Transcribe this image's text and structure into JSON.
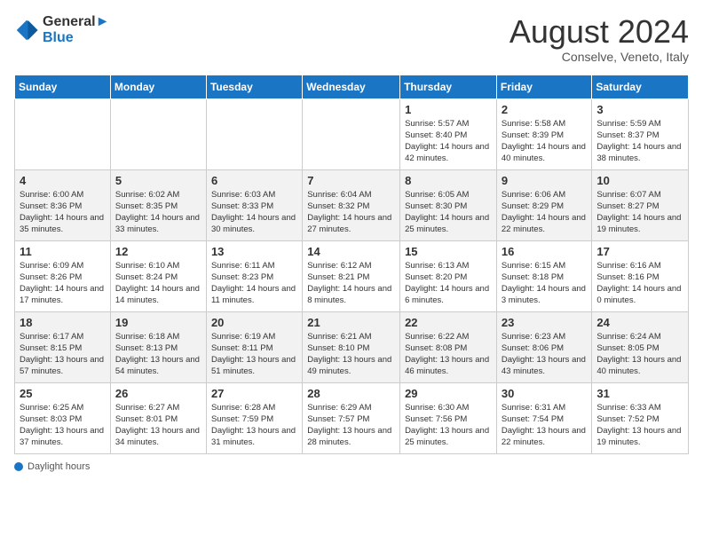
{
  "header": {
    "logo_line1": "General",
    "logo_line2": "Blue",
    "month_title": "August 2024",
    "location": "Conselve, Veneto, Italy"
  },
  "calendar": {
    "days_of_week": [
      "Sunday",
      "Monday",
      "Tuesday",
      "Wednesday",
      "Thursday",
      "Friday",
      "Saturday"
    ],
    "weeks": [
      [
        {
          "day": "",
          "info": ""
        },
        {
          "day": "",
          "info": ""
        },
        {
          "day": "",
          "info": ""
        },
        {
          "day": "",
          "info": ""
        },
        {
          "day": "1",
          "info": "Sunrise: 5:57 AM\nSunset: 8:40 PM\nDaylight: 14 hours and 42 minutes."
        },
        {
          "day": "2",
          "info": "Sunrise: 5:58 AM\nSunset: 8:39 PM\nDaylight: 14 hours and 40 minutes."
        },
        {
          "day": "3",
          "info": "Sunrise: 5:59 AM\nSunset: 8:37 PM\nDaylight: 14 hours and 38 minutes."
        }
      ],
      [
        {
          "day": "4",
          "info": "Sunrise: 6:00 AM\nSunset: 8:36 PM\nDaylight: 14 hours and 35 minutes."
        },
        {
          "day": "5",
          "info": "Sunrise: 6:02 AM\nSunset: 8:35 PM\nDaylight: 14 hours and 33 minutes."
        },
        {
          "day": "6",
          "info": "Sunrise: 6:03 AM\nSunset: 8:33 PM\nDaylight: 14 hours and 30 minutes."
        },
        {
          "day": "7",
          "info": "Sunrise: 6:04 AM\nSunset: 8:32 PM\nDaylight: 14 hours and 27 minutes."
        },
        {
          "day": "8",
          "info": "Sunrise: 6:05 AM\nSunset: 8:30 PM\nDaylight: 14 hours and 25 minutes."
        },
        {
          "day": "9",
          "info": "Sunrise: 6:06 AM\nSunset: 8:29 PM\nDaylight: 14 hours and 22 minutes."
        },
        {
          "day": "10",
          "info": "Sunrise: 6:07 AM\nSunset: 8:27 PM\nDaylight: 14 hours and 19 minutes."
        }
      ],
      [
        {
          "day": "11",
          "info": "Sunrise: 6:09 AM\nSunset: 8:26 PM\nDaylight: 14 hours and 17 minutes."
        },
        {
          "day": "12",
          "info": "Sunrise: 6:10 AM\nSunset: 8:24 PM\nDaylight: 14 hours and 14 minutes."
        },
        {
          "day": "13",
          "info": "Sunrise: 6:11 AM\nSunset: 8:23 PM\nDaylight: 14 hours and 11 minutes."
        },
        {
          "day": "14",
          "info": "Sunrise: 6:12 AM\nSunset: 8:21 PM\nDaylight: 14 hours and 8 minutes."
        },
        {
          "day": "15",
          "info": "Sunrise: 6:13 AM\nSunset: 8:20 PM\nDaylight: 14 hours and 6 minutes."
        },
        {
          "day": "16",
          "info": "Sunrise: 6:15 AM\nSunset: 8:18 PM\nDaylight: 14 hours and 3 minutes."
        },
        {
          "day": "17",
          "info": "Sunrise: 6:16 AM\nSunset: 8:16 PM\nDaylight: 14 hours and 0 minutes."
        }
      ],
      [
        {
          "day": "18",
          "info": "Sunrise: 6:17 AM\nSunset: 8:15 PM\nDaylight: 13 hours and 57 minutes."
        },
        {
          "day": "19",
          "info": "Sunrise: 6:18 AM\nSunset: 8:13 PM\nDaylight: 13 hours and 54 minutes."
        },
        {
          "day": "20",
          "info": "Sunrise: 6:19 AM\nSunset: 8:11 PM\nDaylight: 13 hours and 51 minutes."
        },
        {
          "day": "21",
          "info": "Sunrise: 6:21 AM\nSunset: 8:10 PM\nDaylight: 13 hours and 49 minutes."
        },
        {
          "day": "22",
          "info": "Sunrise: 6:22 AM\nSunset: 8:08 PM\nDaylight: 13 hours and 46 minutes."
        },
        {
          "day": "23",
          "info": "Sunrise: 6:23 AM\nSunset: 8:06 PM\nDaylight: 13 hours and 43 minutes."
        },
        {
          "day": "24",
          "info": "Sunrise: 6:24 AM\nSunset: 8:05 PM\nDaylight: 13 hours and 40 minutes."
        }
      ],
      [
        {
          "day": "25",
          "info": "Sunrise: 6:25 AM\nSunset: 8:03 PM\nDaylight: 13 hours and 37 minutes."
        },
        {
          "day": "26",
          "info": "Sunrise: 6:27 AM\nSunset: 8:01 PM\nDaylight: 13 hours and 34 minutes."
        },
        {
          "day": "27",
          "info": "Sunrise: 6:28 AM\nSunset: 7:59 PM\nDaylight: 13 hours and 31 minutes."
        },
        {
          "day": "28",
          "info": "Sunrise: 6:29 AM\nSunset: 7:57 PM\nDaylight: 13 hours and 28 minutes."
        },
        {
          "day": "29",
          "info": "Sunrise: 6:30 AM\nSunset: 7:56 PM\nDaylight: 13 hours and 25 minutes."
        },
        {
          "day": "30",
          "info": "Sunrise: 6:31 AM\nSunset: 7:54 PM\nDaylight: 13 hours and 22 minutes."
        },
        {
          "day": "31",
          "info": "Sunrise: 6:33 AM\nSunset: 7:52 PM\nDaylight: 13 hours and 19 minutes."
        }
      ]
    ]
  },
  "footer": {
    "daylight_label": "Daylight hours"
  }
}
